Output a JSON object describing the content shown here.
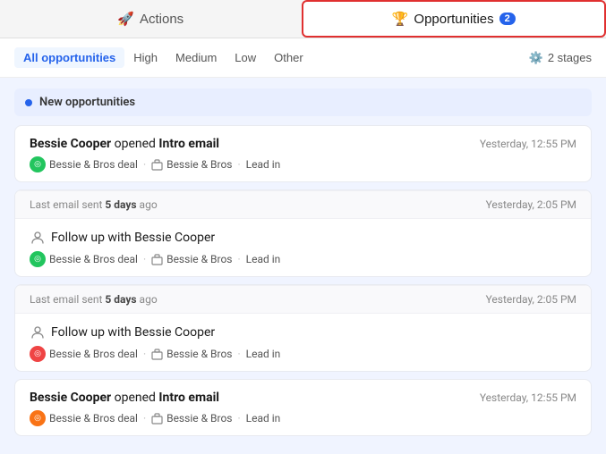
{
  "topTabs": [
    {
      "id": "actions",
      "label": "Actions",
      "icon": "rocket",
      "active": false
    },
    {
      "id": "opportunities",
      "label": "Opportunities",
      "icon": "opportunities",
      "active": true,
      "badge": "2"
    }
  ],
  "filters": {
    "items": [
      {
        "id": "all",
        "label": "All opportunities",
        "active": true
      },
      {
        "id": "high",
        "label": "High",
        "active": false
      },
      {
        "id": "medium",
        "label": "Medium",
        "active": false
      },
      {
        "id": "low",
        "label": "Low",
        "active": false
      },
      {
        "id": "other",
        "label": "Other",
        "active": false
      }
    ],
    "stagesLabel": "2 stages"
  },
  "section": {
    "title": "New opportunities"
  },
  "cards": [
    {
      "type": "email",
      "title_pre": "",
      "title_person": "Bessie Cooper",
      "title_action": " opened ",
      "title_item": "Intro email",
      "time": "Yesterday, 12:55 PM",
      "deal": "Bessie & Bros deal",
      "deal_color": "green",
      "company": "Bessie & Bros",
      "stage": "Lead in"
    },
    {
      "type": "separator",
      "left": "Last email sent ",
      "left_bold": "5 days",
      "left_suffix": " ago",
      "right": "Yesterday, 2:05 PM"
    },
    {
      "type": "followup",
      "title": "Follow up with Bessie Cooper",
      "deal": "Bessie & Bros deal",
      "deal_color": "green",
      "company": "Bessie & Bros",
      "stage": "Lead in"
    },
    {
      "type": "separator",
      "left": "Last email sent ",
      "left_bold": "5 days",
      "left_suffix": " ago",
      "right": "Yesterday, 2:05 PM"
    },
    {
      "type": "followup",
      "title": "Follow up with Bessie Cooper",
      "deal": "Bessie & Bros deal",
      "deal_color": "red",
      "company": "Bessie & Bros",
      "stage": "Lead in"
    },
    {
      "type": "email",
      "title_person": "Bessie Cooper",
      "title_action": " opened ",
      "title_item": "Intro email",
      "time": "Yesterday, 12:55 PM",
      "deal": "Bessie & Bros deal",
      "deal_color": "orange",
      "company": "Bessie & Bros",
      "stage": "Lead in"
    }
  ]
}
